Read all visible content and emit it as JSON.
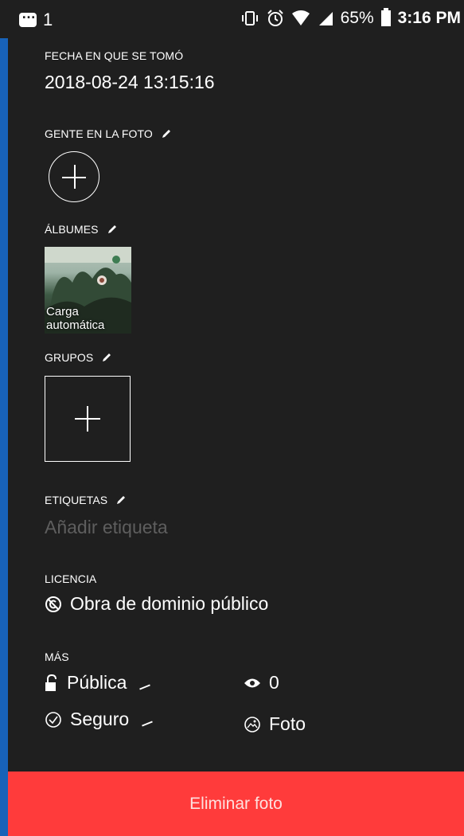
{
  "statusbar": {
    "notification_count": "1",
    "battery_percent": "65%",
    "time": "3:16 PM"
  },
  "date_taken": {
    "label": "FECHA EN QUE SE TOMÓ",
    "value": "2018-08-24 13:15:16"
  },
  "people": {
    "label": "GENTE EN LA FOTO"
  },
  "albums": {
    "label": "ÁLBUMES",
    "items": [
      {
        "name_line1": "Carga",
        "name_line2": "automática"
      }
    ]
  },
  "groups": {
    "label": "GRUPOS"
  },
  "tags": {
    "label": "ETIQUETAS",
    "placeholder": "Añadir etiqueta"
  },
  "license": {
    "label": "LICENCIA",
    "value": "Obra de dominio público"
  },
  "more": {
    "label": "MÁS",
    "privacy": "Pública",
    "views": "0",
    "safety": "Seguro",
    "content_type": "Foto"
  },
  "delete_button": {
    "label": "Eliminar foto"
  },
  "colors": {
    "panel": "#1f1f1f",
    "outer": "#1862b8",
    "delete": "#ff3b3b",
    "placeholder": "#5e5e5e"
  }
}
